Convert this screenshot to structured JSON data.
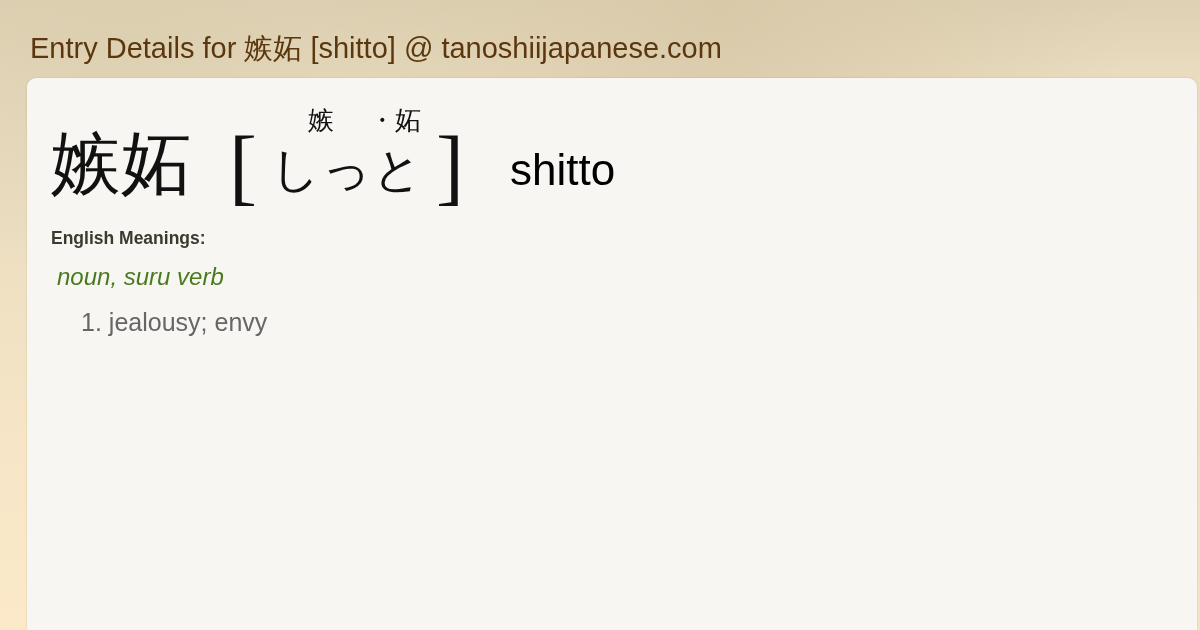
{
  "page": {
    "title": "Entry Details for 嫉妬 [shitto] @ tanoshiijapanese.com"
  },
  "entry": {
    "headword": "嫉妬",
    "reading": {
      "open_bracket": "[",
      "kanji_marks": [
        "嫉",
        "・妬"
      ],
      "kana": "しっと",
      "close_bracket": "]"
    },
    "romaji": "shitto",
    "meanings_heading": "English Meanings:",
    "part_of_speech": "noun, suru verb",
    "senses": [
      {
        "number": "1.",
        "text": "jealousy; envy"
      }
    ]
  }
}
